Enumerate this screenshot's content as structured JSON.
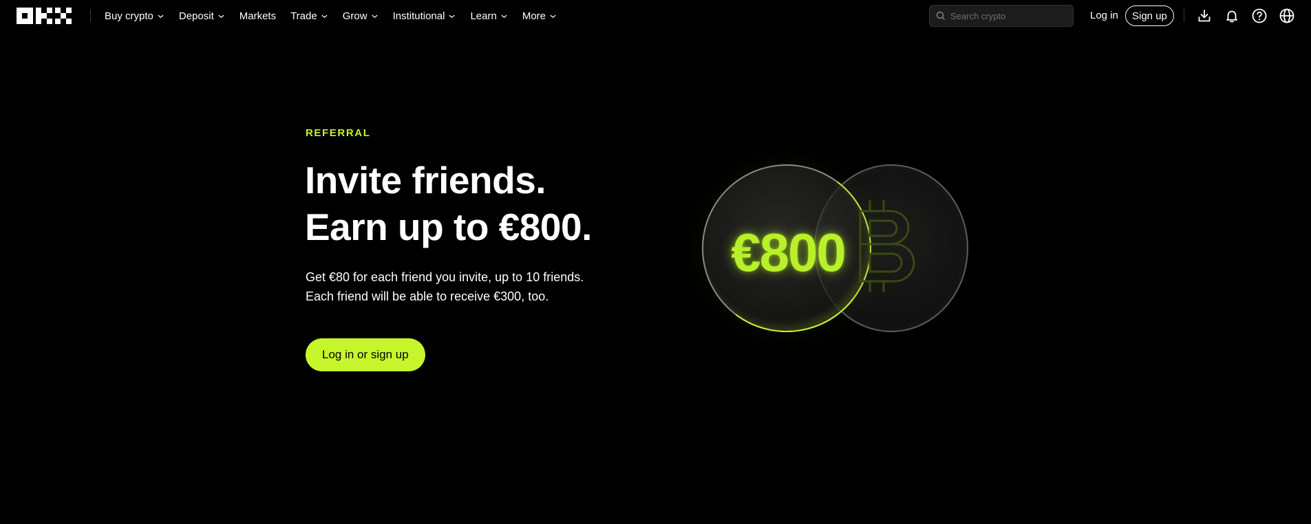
{
  "nav": {
    "logo_text": "OKX",
    "menu": [
      {
        "label": "Buy crypto",
        "has_dropdown": true
      },
      {
        "label": "Deposit",
        "has_dropdown": true
      },
      {
        "label": "Markets",
        "has_dropdown": false
      },
      {
        "label": "Trade",
        "has_dropdown": true
      },
      {
        "label": "Grow",
        "has_dropdown": true
      },
      {
        "label": "Institutional",
        "has_dropdown": true
      },
      {
        "label": "Learn",
        "has_dropdown": true
      },
      {
        "label": "More",
        "has_dropdown": true
      }
    ],
    "search": {
      "placeholder": "Search crypto",
      "value": ""
    },
    "login_label": "Log in",
    "signup_label": "Sign up",
    "icons": [
      "download-icon",
      "bell-icon",
      "help-icon",
      "globe-icon"
    ]
  },
  "hero": {
    "eyebrow": "REFERRAL",
    "headline_line1": "Invite friends.",
    "headline_line2": "Earn up to €800.",
    "sub_line1": "Get €80 for each friend you invite, up to 10 friends.",
    "sub_line2": "Each friend will be able to receive €300, too.",
    "cta_label": "Log in or sign up",
    "coin_amount": "€800",
    "coin_symbol": "bitcoin-icon"
  },
  "colors": {
    "background": "#000000",
    "accent": "#c6f52b",
    "text": "#ffffff"
  }
}
